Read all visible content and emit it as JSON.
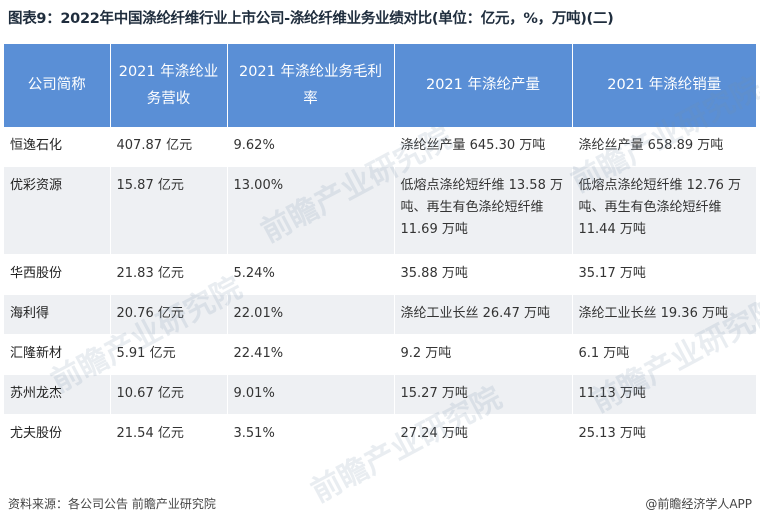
{
  "title": "图表9：2022年中国涤纶纤维行业上市公司-涤纶纤维业务业绩对比(单位：亿元，%，万吨)(二)",
  "table": {
    "headers": [
      "公司简称",
      "2021 年涤纶业务营收",
      "2021 年涤纶业务毛利率",
      "2021 年涤纶产量",
      "2021 年涤纶销量"
    ],
    "rows": [
      [
        "恒逸石化",
        "407.87 亿元",
        "9.62%",
        "涤纶丝产量 645.30 万吨",
        "涤纶丝产量 658.89 万吨"
      ],
      [
        "优彩资源",
        "15.87 亿元",
        "13.00%",
        "低熔点涤纶短纤维 13.58 万吨、再生有色涤纶短纤维 11.69 万吨",
        "低熔点涤纶短纤维 12.76 万吨、再生有色涤纶短纤维 11.44 万吨"
      ],
      [
        "华西股份",
        "21.83 亿元",
        "5.24%",
        "35.88 万吨",
        "35.17 万吨"
      ],
      [
        "海利得",
        "20.76 亿元",
        "22.01%",
        "涤纶工业长丝 26.47 万吨",
        "涤纶工业长丝 19.36 万吨"
      ],
      [
        "汇隆新材",
        "5.91 亿元",
        "22.41%",
        "9.2 万吨",
        "6.1 万吨"
      ],
      [
        "苏州龙杰",
        "10.67 亿元",
        "9.01%",
        "15.27 万吨",
        "11.13 万吨"
      ],
      [
        "尤夫股份",
        "21.54 亿元",
        "3.51%",
        "27.24 万吨",
        "25.13 万吨"
      ]
    ]
  },
  "footer": {
    "source": "资料来源：各公司公告 前瞻产业研究院",
    "credit": "@前瞻经济学人APP"
  },
  "watermark_text": "前瞻产业研究院",
  "colors": {
    "header_bg": "#5a8fd6",
    "stripe_bg": "#eef0f3"
  }
}
